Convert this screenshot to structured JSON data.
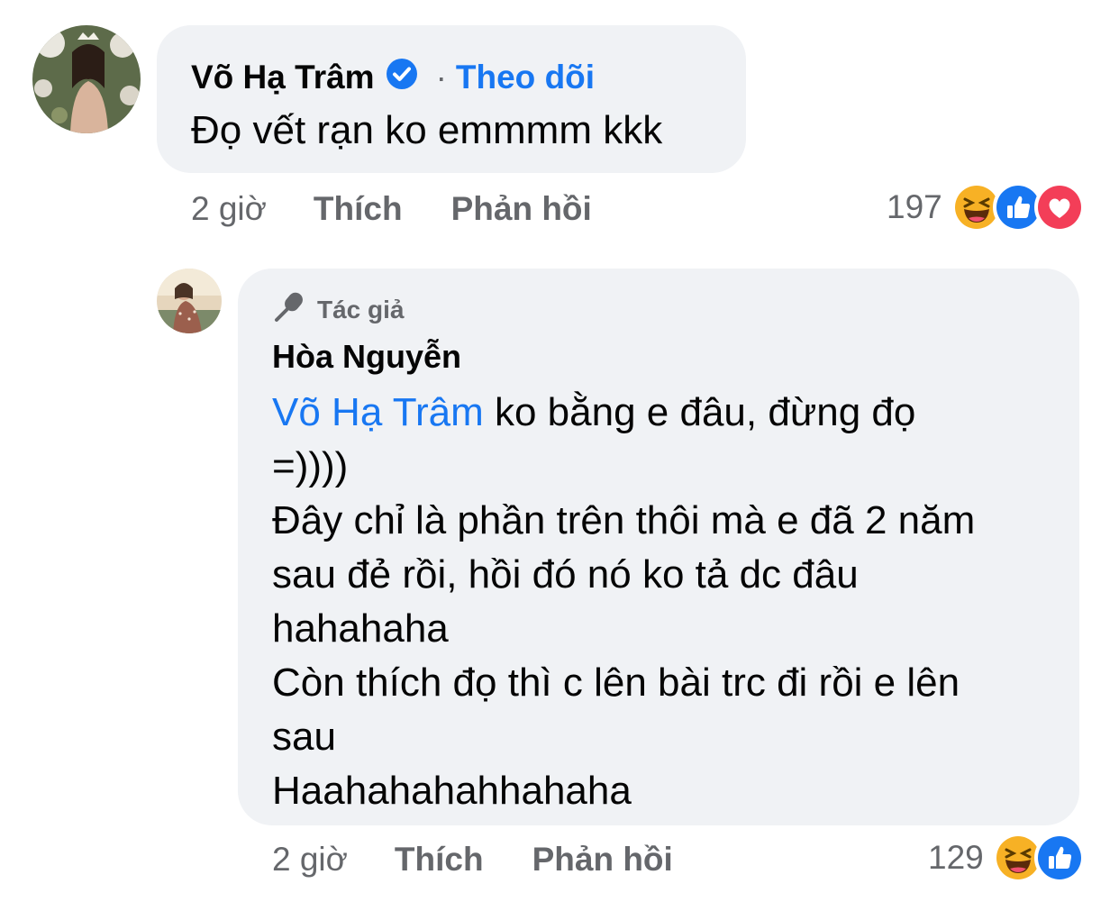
{
  "comment1": {
    "author": "Võ Hạ Trâm",
    "verified": true,
    "follow_separator": "·",
    "follow_label": "Theo dõi",
    "text": "Đọ vết rạn ko emmmm kkk",
    "time": "2 giờ",
    "like_label": "Thích",
    "reply_label": "Phản hồi",
    "reaction_count": "197",
    "reaction_icons": [
      "haha-icon",
      "like-icon",
      "love-icon"
    ]
  },
  "reply1": {
    "badge_icon": "microphone-icon",
    "badge_label": "Tác giả",
    "author": "Hòa Nguyễn",
    "mention": "Võ Hạ Trâm",
    "lines": {
      "l1": "ko bằng e đâu, đừng đọ",
      "l2": "=))))",
      "l3": "Đây chỉ là phần trên thôi mà e đã 2 năm",
      "l4": "sau đẻ rồi, hồi đó nó ko tả dc đâu",
      "l5": "hahahaha",
      "l6": "Còn thích đọ thì c lên bài trc đi rồi e lên",
      "l7": "sau",
      "l8": "Haahahahahhahaha"
    },
    "time": "2 giờ",
    "like_label": "Thích",
    "reply_label": "Phản hồi",
    "reaction_count": "129",
    "reaction_icons": [
      "haha-icon",
      "like-icon"
    ]
  },
  "colors": {
    "bubble": "#f0f2f5",
    "link": "#1877f2",
    "meta": "#65676b",
    "text": "#050505",
    "like": "#1877f2",
    "love": "#f33e58",
    "haha": "#f7b125"
  }
}
